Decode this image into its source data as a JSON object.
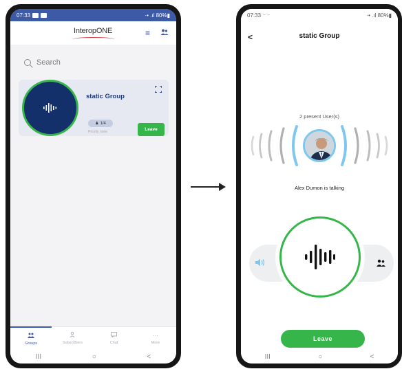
{
  "left_phone": {
    "statusbar": {
      "time": "07:33",
      "battery": "·• .ıl 80%▮"
    },
    "header": {
      "logo_text": "InteropONE"
    },
    "search": {
      "placeholder": "Search"
    },
    "group_card": {
      "title": "static Group",
      "member_count": "1/4",
      "subtitle": "Priority none",
      "leave_label": "Leave"
    },
    "bottom_nav": [
      {
        "label": "Groups",
        "icon": "groups-icon"
      },
      {
        "label": "Subscribers",
        "icon": "subscribers-icon"
      },
      {
        "label": "Chat",
        "icon": "chat-icon"
      },
      {
        "label": "More",
        "icon": "more-icon"
      }
    ],
    "system_nav": {
      "recents": "III",
      "home": "○",
      "back": "<"
    }
  },
  "right_phone": {
    "statusbar": {
      "time": "07:33",
      "battery": "·• .ıl 80%▮"
    },
    "header": {
      "back": "<",
      "title": "static Group"
    },
    "present_users": "2 present User(s)",
    "talking_status": "Alex Dumon is talking",
    "leave_label": "Leave",
    "system_nav": {
      "recents": "III",
      "home": "○",
      "back": "<"
    }
  },
  "colors": {
    "brand_blue": "#3c5aa6",
    "dark_navy": "#14306b",
    "green": "#36b54a",
    "wave_blue": "#7fc7ee"
  }
}
